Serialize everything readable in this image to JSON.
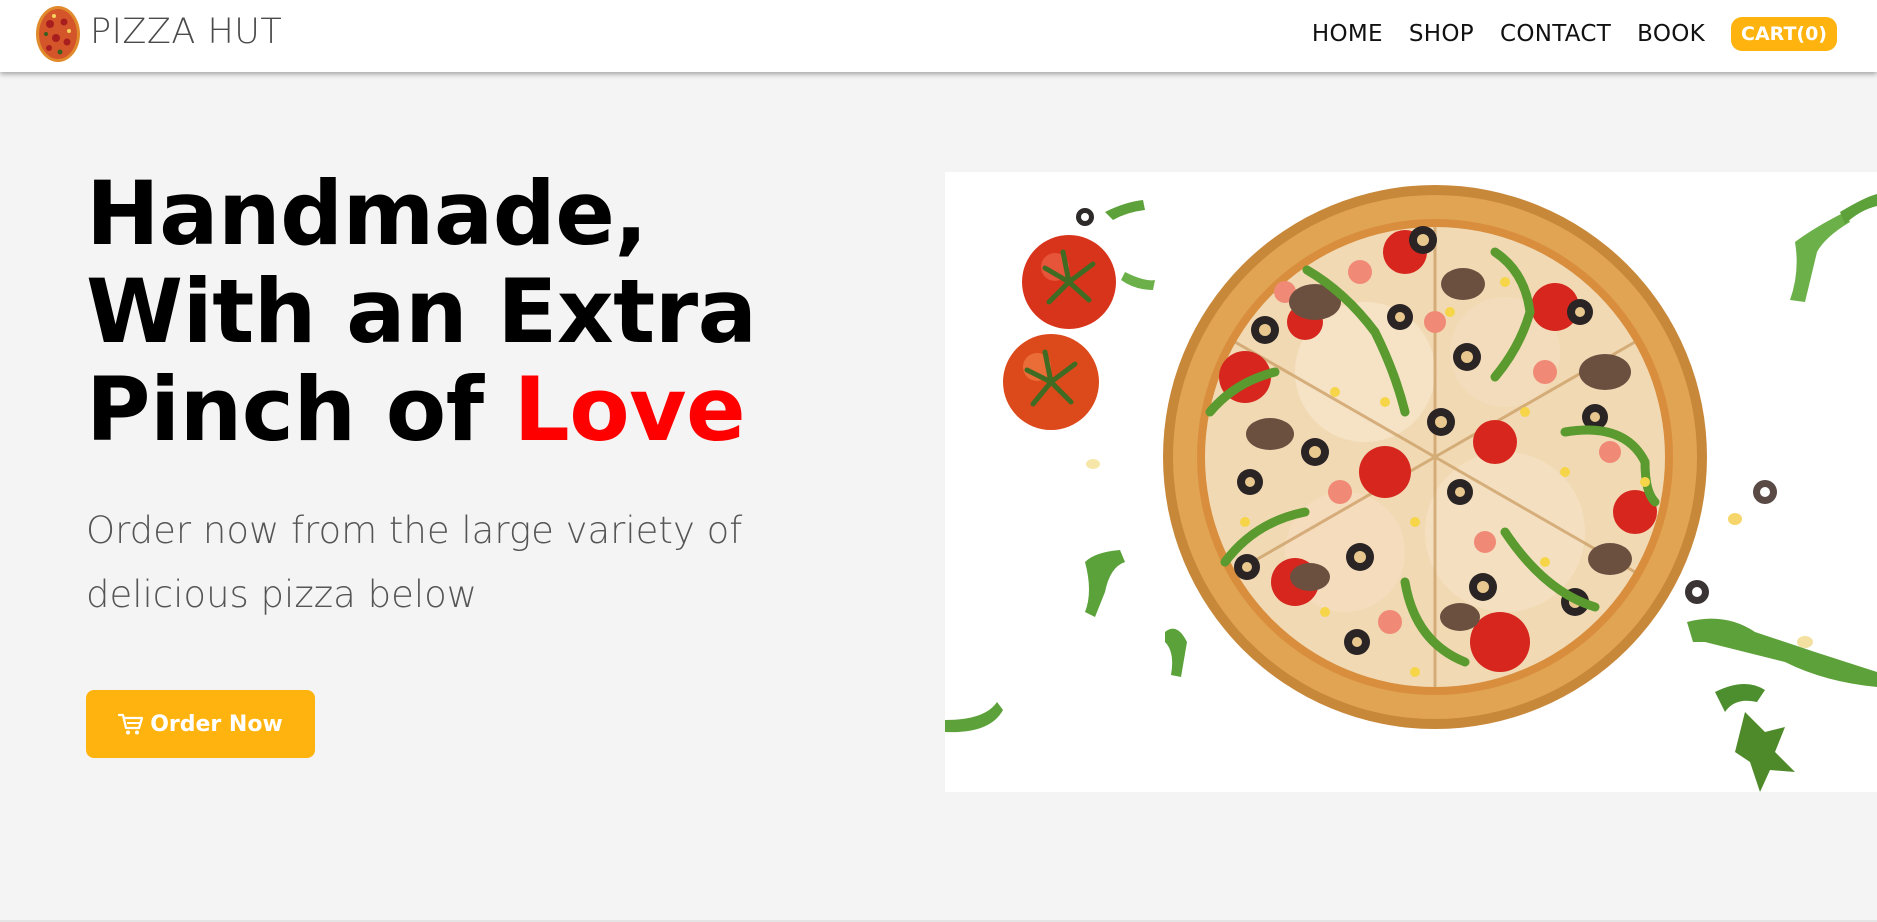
{
  "brand": {
    "name": "PIZZA HUT",
    "logo_icon": "pizza-logo-icon"
  },
  "nav": {
    "items": [
      {
        "label": "HOME"
      },
      {
        "label": "SHOP"
      },
      {
        "label": "CONTACT"
      },
      {
        "label": "BOOK"
      }
    ],
    "cart_label": "CART(0)"
  },
  "hero": {
    "headline_line1": "Handmade,",
    "headline_line2": "With an Extra",
    "headline_line3_prefix": "Pinch of ",
    "headline_line3_highlight": "Love",
    "subtitle": "Order now from the large variety of delicious pizza below",
    "cta_label": "Order Now",
    "cta_icon": "shopping-cart-icon",
    "image": "pizza-with-toppings-image"
  },
  "colors": {
    "accent": "#ffb30f",
    "highlight": "#ff0000",
    "background": "#f4f4f4",
    "navbar": "#ffffff"
  }
}
